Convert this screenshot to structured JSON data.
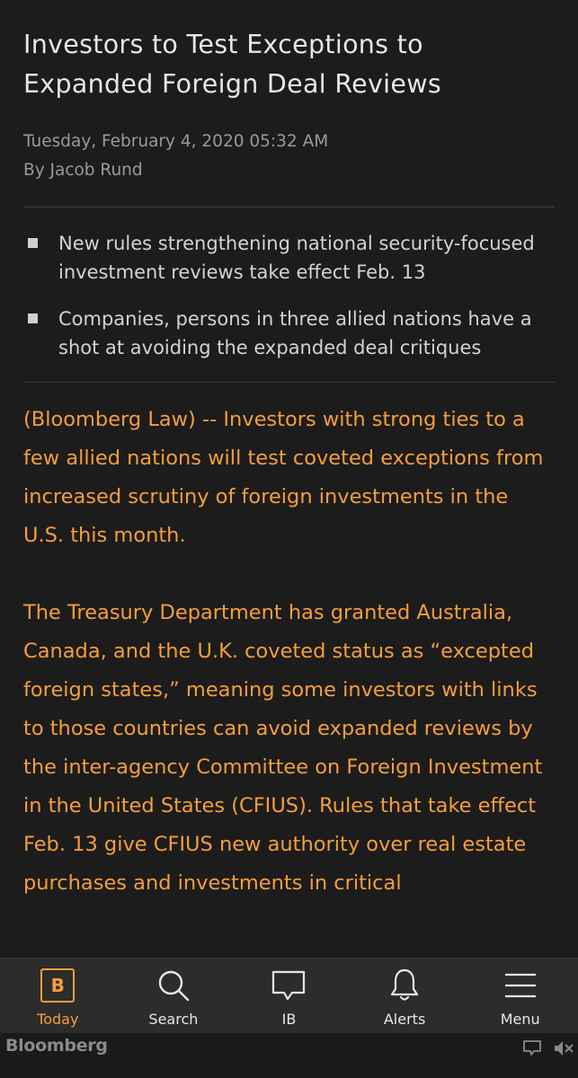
{
  "article": {
    "headline": "Investors to Test Exceptions to Expanded Foreign Deal Reviews",
    "date": "Tuesday, February 4, 2020 05:32 AM",
    "byline": "By Jacob Rund",
    "bullets": [
      "New rules strengthening national security-focused investment reviews take effect Feb. 13",
      "Companies, persons in three allied nations have a shot at avoiding the expanded deal critiques"
    ],
    "paragraphs": [
      "(Bloomberg Law) -- Investors with strong ties to a few allied nations will test coveted exceptions from increased scrutiny of foreign investments in the U.S. this month.",
      "The Treasury Department has granted Australia, Canada, and the U.K. coveted status as “excepted foreign states,” meaning some investors with links to those countries can avoid expanded reviews by the inter-agency Committee on Foreign Investment in the United States (CFIUS). Rules that take effect Feb. 13 give CFIUS new authority over real estate purchases and investments in critical"
    ]
  },
  "tabbar": {
    "today_glyph": "B",
    "today": "Today",
    "search": "Search",
    "ib": "IB",
    "alerts": "Alerts",
    "menu": "Menu"
  },
  "footer": {
    "logo": "Bloomberg"
  },
  "colors": {
    "accent": "#f59e3a",
    "background": "#1c1c1c",
    "tabbar": "#2c2c2c"
  }
}
